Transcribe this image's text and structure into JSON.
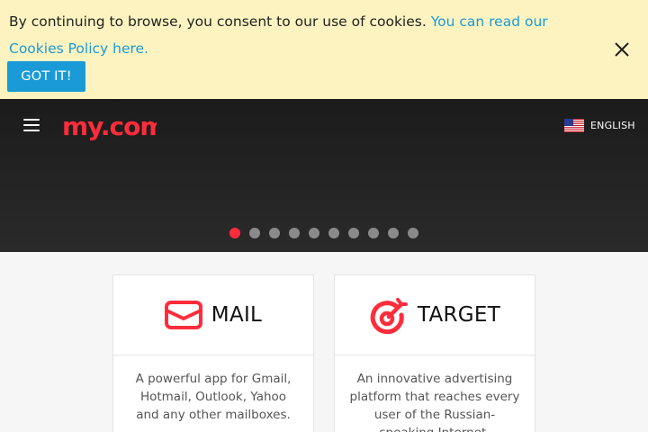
{
  "cookie_banner": {
    "text": "By continuing to browse, you consent to our use of cookies. ",
    "link_text": "You can read our Cookies Policy here.",
    "accept_label": "GOT IT!"
  },
  "header": {
    "logo_text": "my.com",
    "language_label": "ENGLISH"
  },
  "carousel": {
    "slide_count": 10,
    "active_index": 0
  },
  "products": [
    {
      "title": "MAIL",
      "icon": "mail-icon",
      "description": "A powerful app for Gmail, Hotmail, Outlook, Yahoo and any other mailboxes."
    },
    {
      "title": "TARGET",
      "icon": "target-icon",
      "description": "An innovative advertising platform that reaches every user of the Russian-speaking Internet."
    }
  ],
  "colors": {
    "brand_red": "#ff2d3b",
    "link_blue": "#1a9bd7",
    "banner_bg": "#fdf3c0"
  }
}
